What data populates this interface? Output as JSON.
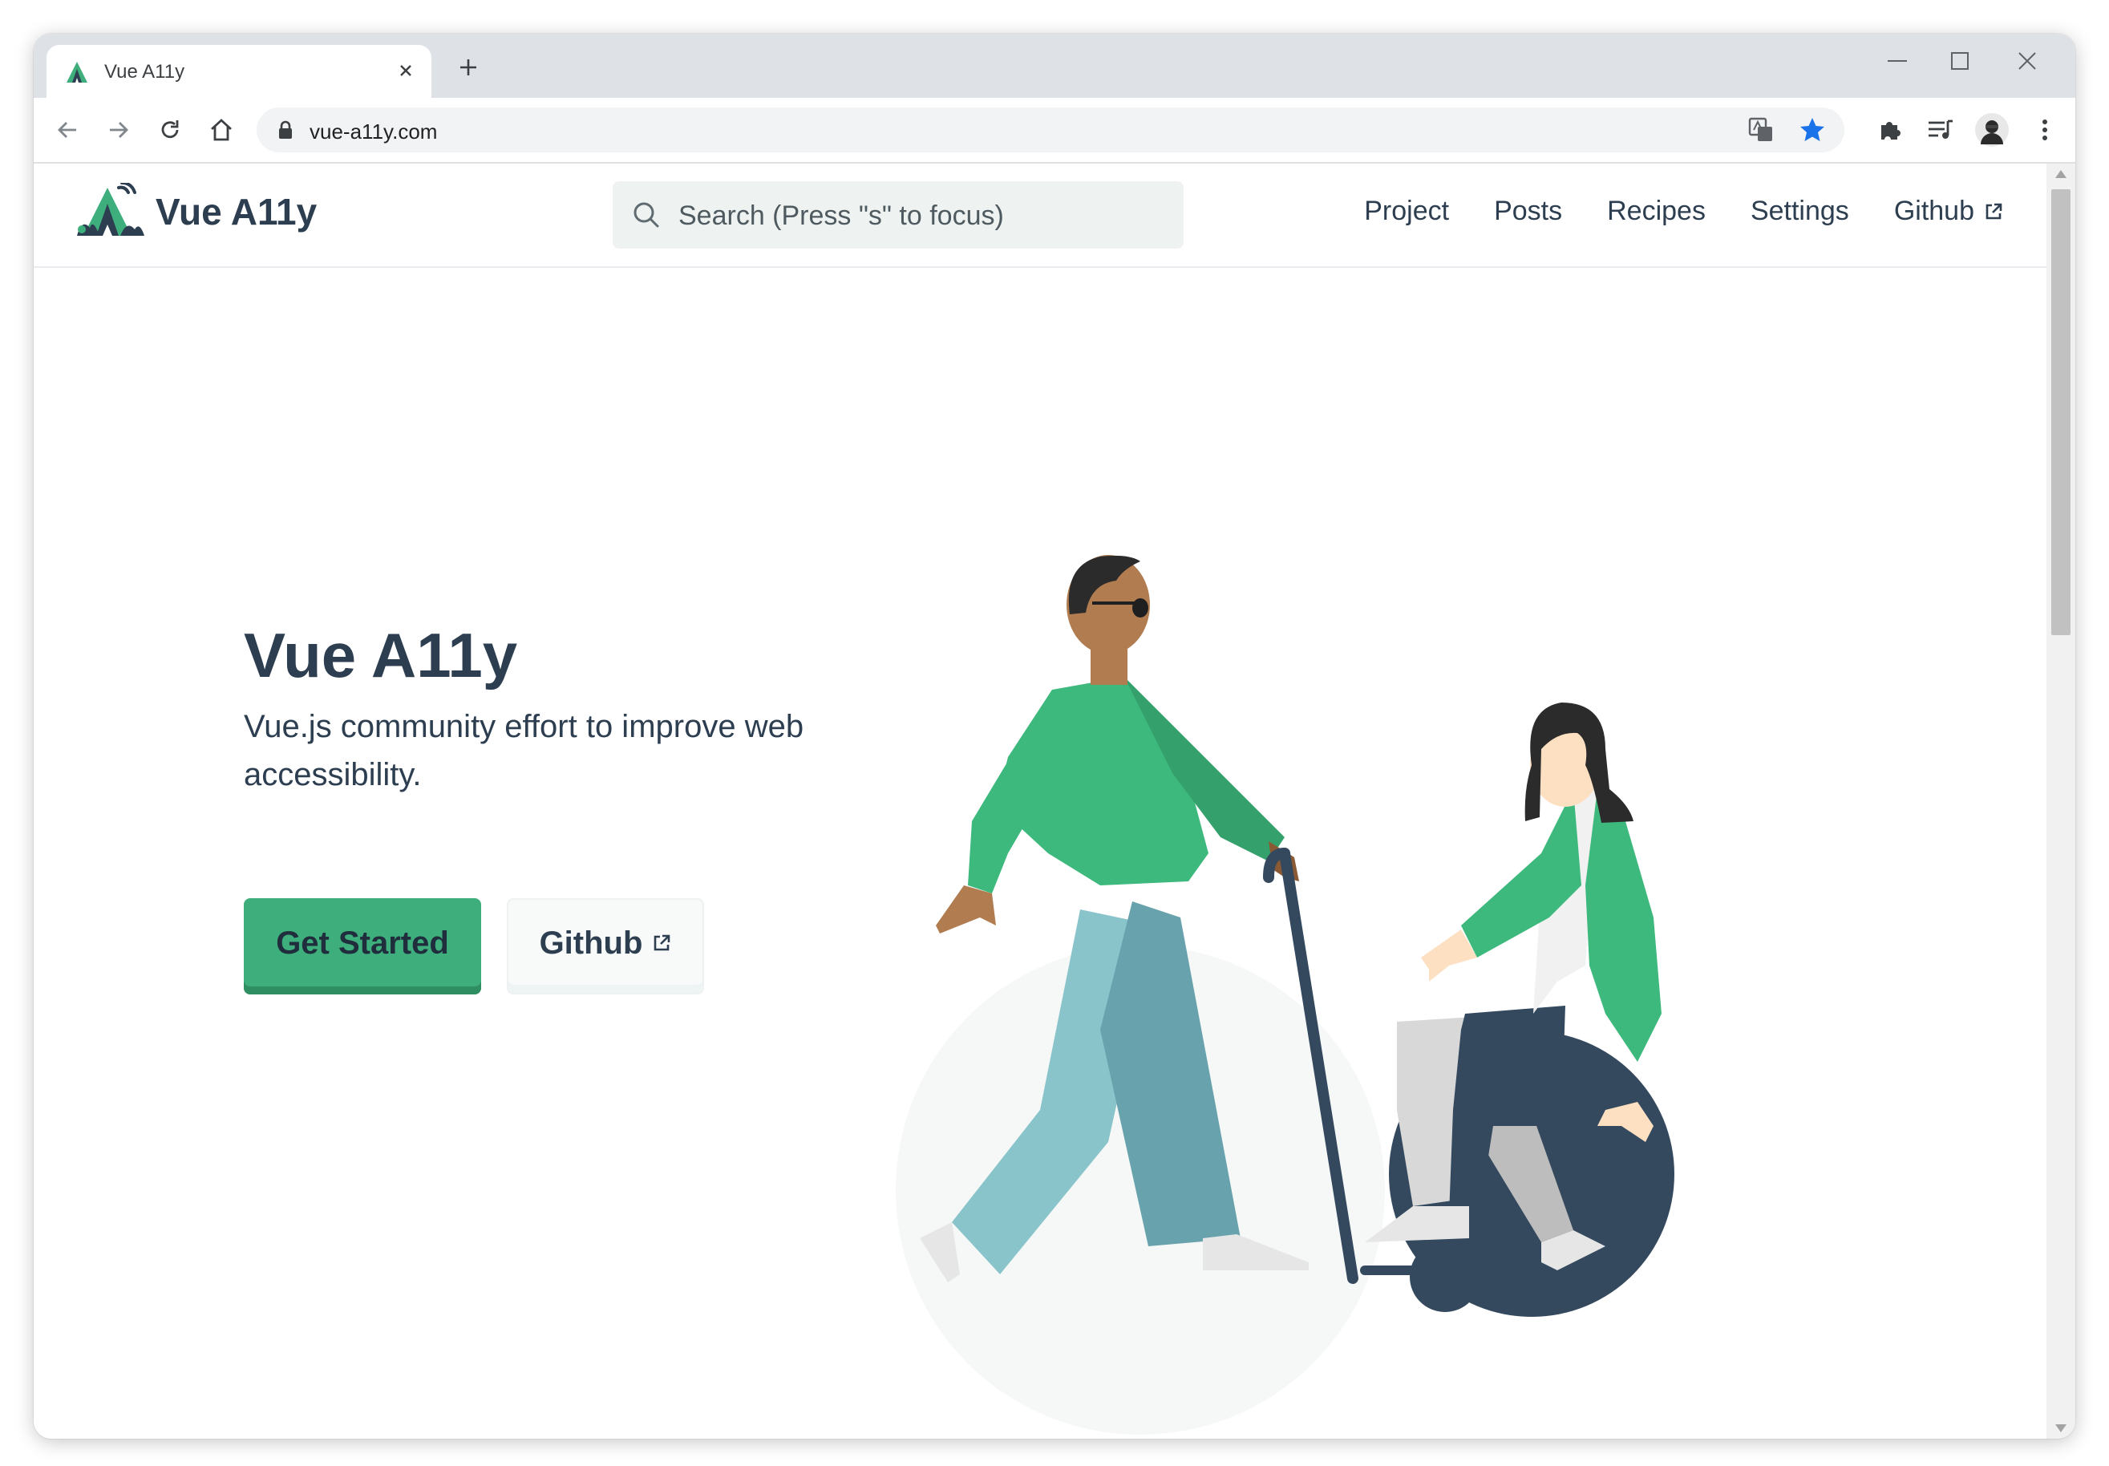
{
  "browser": {
    "tab_title": "Vue A11y",
    "url": "vue-a11y.com",
    "icons": [
      "favicon-vue-a11y",
      "close-icon",
      "plus-icon",
      "minimize-icon",
      "maximize-icon",
      "close-window-icon",
      "back-icon",
      "forward-icon",
      "reload-icon",
      "home-icon",
      "lock-icon",
      "translate-icon",
      "star-icon",
      "extensions-icon",
      "reading-list-icon",
      "avatar",
      "menu-kebab-icon"
    ],
    "colors": {
      "tabstrip": "#dee1e6",
      "star": "#1a73e8"
    }
  },
  "site": {
    "brand": "Vue A11y",
    "search_placeholder": "Search (Press \"s\" to focus)",
    "nav": [
      {
        "label": "Project"
      },
      {
        "label": "Posts"
      },
      {
        "label": "Recipes"
      },
      {
        "label": "Settings"
      },
      {
        "label": "Github",
        "external": true
      }
    ],
    "colors": {
      "accent": "#3eaf7c",
      "text": "#2c3e50"
    }
  },
  "hero": {
    "title": "Vue A11y",
    "tagline": "Vue.js community effort to improve web accessibility.",
    "primary_button": "Get Started",
    "secondary_button": "Github"
  }
}
